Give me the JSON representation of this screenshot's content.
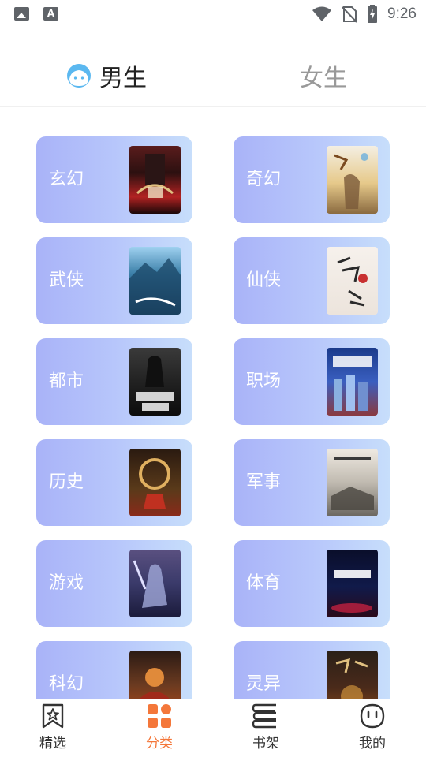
{
  "status_bar": {
    "time": "9:26",
    "notif_a_letter": "A"
  },
  "gender_tabs": {
    "male": "男生",
    "female": "女生"
  },
  "colors": {
    "accent": "#f4773a",
    "card_start": "#a9b3f8",
    "card_end": "#c7defb",
    "inactive_tab": "#999999"
  },
  "categories": [
    {
      "label": "玄幻"
    },
    {
      "label": "奇幻"
    },
    {
      "label": "武侠"
    },
    {
      "label": "仙侠"
    },
    {
      "label": "都市"
    },
    {
      "label": "职场"
    },
    {
      "label": "历史"
    },
    {
      "label": "军事"
    },
    {
      "label": "游戏"
    },
    {
      "label": "体育"
    },
    {
      "label": "科幻"
    },
    {
      "label": "灵异"
    }
  ],
  "bottom_nav": [
    {
      "label": "精选",
      "icon": "bookmark-star-icon"
    },
    {
      "label": "分类",
      "icon": "grid-icon",
      "active": true
    },
    {
      "label": "书架",
      "icon": "bookshelf-icon"
    },
    {
      "label": "我的",
      "icon": "face-icon"
    }
  ]
}
